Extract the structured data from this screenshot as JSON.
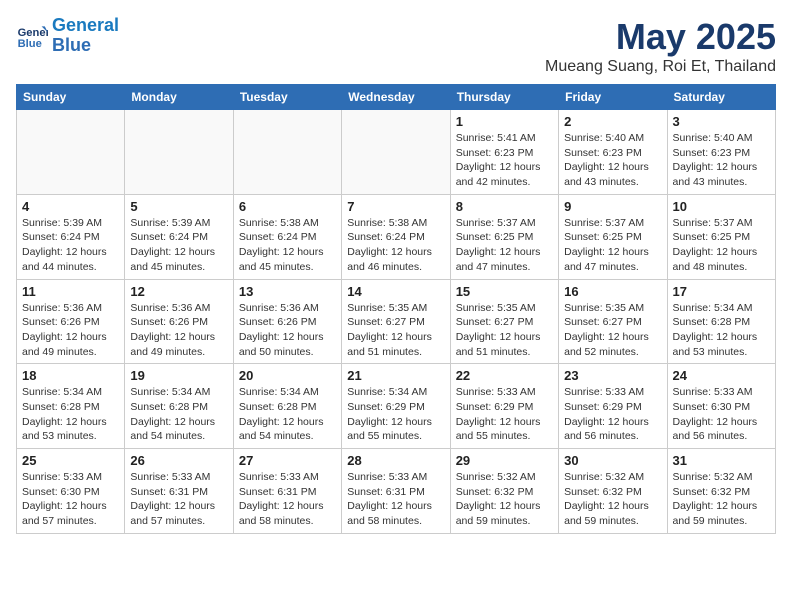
{
  "header": {
    "logo_line1": "General",
    "logo_line2": "Blue",
    "month_year": "May 2025",
    "location": "Mueang Suang, Roi Et, Thailand"
  },
  "days_of_week": [
    "Sunday",
    "Monday",
    "Tuesday",
    "Wednesday",
    "Thursday",
    "Friday",
    "Saturday"
  ],
  "weeks": [
    [
      {
        "day": "",
        "info": ""
      },
      {
        "day": "",
        "info": ""
      },
      {
        "day": "",
        "info": ""
      },
      {
        "day": "",
        "info": ""
      },
      {
        "day": "1",
        "info": "Sunrise: 5:41 AM\nSunset: 6:23 PM\nDaylight: 12 hours\nand 42 minutes."
      },
      {
        "day": "2",
        "info": "Sunrise: 5:40 AM\nSunset: 6:23 PM\nDaylight: 12 hours\nand 43 minutes."
      },
      {
        "day": "3",
        "info": "Sunrise: 5:40 AM\nSunset: 6:23 PM\nDaylight: 12 hours\nand 43 minutes."
      }
    ],
    [
      {
        "day": "4",
        "info": "Sunrise: 5:39 AM\nSunset: 6:24 PM\nDaylight: 12 hours\nand 44 minutes."
      },
      {
        "day": "5",
        "info": "Sunrise: 5:39 AM\nSunset: 6:24 PM\nDaylight: 12 hours\nand 45 minutes."
      },
      {
        "day": "6",
        "info": "Sunrise: 5:38 AM\nSunset: 6:24 PM\nDaylight: 12 hours\nand 45 minutes."
      },
      {
        "day": "7",
        "info": "Sunrise: 5:38 AM\nSunset: 6:24 PM\nDaylight: 12 hours\nand 46 minutes."
      },
      {
        "day": "8",
        "info": "Sunrise: 5:37 AM\nSunset: 6:25 PM\nDaylight: 12 hours\nand 47 minutes."
      },
      {
        "day": "9",
        "info": "Sunrise: 5:37 AM\nSunset: 6:25 PM\nDaylight: 12 hours\nand 47 minutes."
      },
      {
        "day": "10",
        "info": "Sunrise: 5:37 AM\nSunset: 6:25 PM\nDaylight: 12 hours\nand 48 minutes."
      }
    ],
    [
      {
        "day": "11",
        "info": "Sunrise: 5:36 AM\nSunset: 6:26 PM\nDaylight: 12 hours\nand 49 minutes."
      },
      {
        "day": "12",
        "info": "Sunrise: 5:36 AM\nSunset: 6:26 PM\nDaylight: 12 hours\nand 49 minutes."
      },
      {
        "day": "13",
        "info": "Sunrise: 5:36 AM\nSunset: 6:26 PM\nDaylight: 12 hours\nand 50 minutes."
      },
      {
        "day": "14",
        "info": "Sunrise: 5:35 AM\nSunset: 6:27 PM\nDaylight: 12 hours\nand 51 minutes."
      },
      {
        "day": "15",
        "info": "Sunrise: 5:35 AM\nSunset: 6:27 PM\nDaylight: 12 hours\nand 51 minutes."
      },
      {
        "day": "16",
        "info": "Sunrise: 5:35 AM\nSunset: 6:27 PM\nDaylight: 12 hours\nand 52 minutes."
      },
      {
        "day": "17",
        "info": "Sunrise: 5:34 AM\nSunset: 6:28 PM\nDaylight: 12 hours\nand 53 minutes."
      }
    ],
    [
      {
        "day": "18",
        "info": "Sunrise: 5:34 AM\nSunset: 6:28 PM\nDaylight: 12 hours\nand 53 minutes."
      },
      {
        "day": "19",
        "info": "Sunrise: 5:34 AM\nSunset: 6:28 PM\nDaylight: 12 hours\nand 54 minutes."
      },
      {
        "day": "20",
        "info": "Sunrise: 5:34 AM\nSunset: 6:28 PM\nDaylight: 12 hours\nand 54 minutes."
      },
      {
        "day": "21",
        "info": "Sunrise: 5:34 AM\nSunset: 6:29 PM\nDaylight: 12 hours\nand 55 minutes."
      },
      {
        "day": "22",
        "info": "Sunrise: 5:33 AM\nSunset: 6:29 PM\nDaylight: 12 hours\nand 55 minutes."
      },
      {
        "day": "23",
        "info": "Sunrise: 5:33 AM\nSunset: 6:29 PM\nDaylight: 12 hours\nand 56 minutes."
      },
      {
        "day": "24",
        "info": "Sunrise: 5:33 AM\nSunset: 6:30 PM\nDaylight: 12 hours\nand 56 minutes."
      }
    ],
    [
      {
        "day": "25",
        "info": "Sunrise: 5:33 AM\nSunset: 6:30 PM\nDaylight: 12 hours\nand 57 minutes."
      },
      {
        "day": "26",
        "info": "Sunrise: 5:33 AM\nSunset: 6:31 PM\nDaylight: 12 hours\nand 57 minutes."
      },
      {
        "day": "27",
        "info": "Sunrise: 5:33 AM\nSunset: 6:31 PM\nDaylight: 12 hours\nand 58 minutes."
      },
      {
        "day": "28",
        "info": "Sunrise: 5:33 AM\nSunset: 6:31 PM\nDaylight: 12 hours\nand 58 minutes."
      },
      {
        "day": "29",
        "info": "Sunrise: 5:32 AM\nSunset: 6:32 PM\nDaylight: 12 hours\nand 59 minutes."
      },
      {
        "day": "30",
        "info": "Sunrise: 5:32 AM\nSunset: 6:32 PM\nDaylight: 12 hours\nand 59 minutes."
      },
      {
        "day": "31",
        "info": "Sunrise: 5:32 AM\nSunset: 6:32 PM\nDaylight: 12 hours\nand 59 minutes."
      }
    ]
  ]
}
